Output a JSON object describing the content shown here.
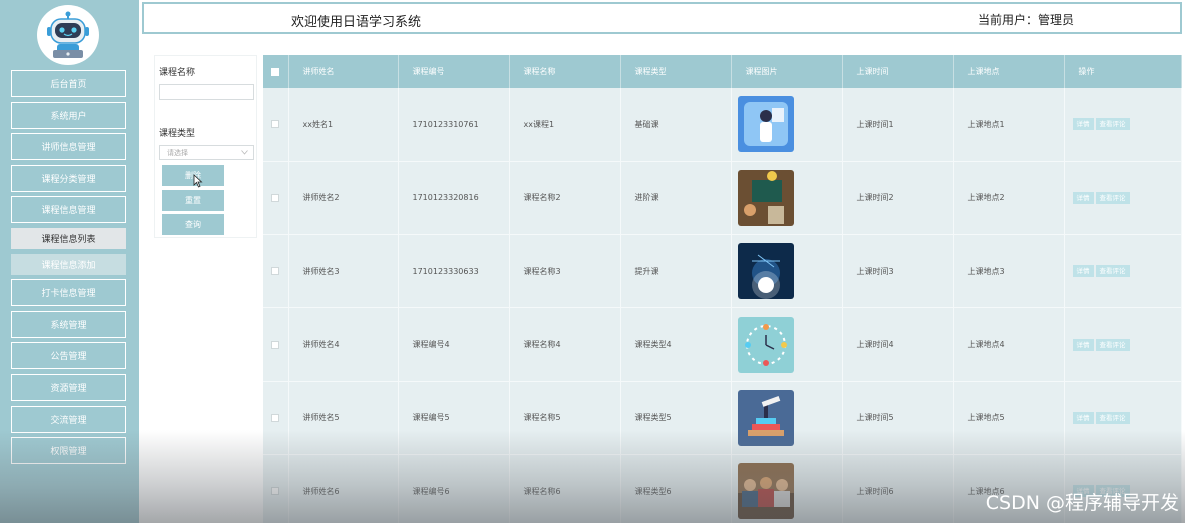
{
  "header": {
    "welcome": "欢迎使用日语学习系统",
    "user_label": "当前用户：",
    "user_name": "管理员"
  },
  "sidebar": {
    "items": [
      {
        "label": "后台首页",
        "state": "normal"
      },
      {
        "label": "系统用户",
        "state": "normal"
      },
      {
        "label": "讲师信息管理",
        "state": "normal"
      },
      {
        "label": "课程分类管理",
        "state": "normal"
      },
      {
        "label": "课程信息管理",
        "state": "normal"
      },
      {
        "label": "课程信息列表",
        "state": "active"
      },
      {
        "label": "课程信息添加",
        "state": "sub"
      },
      {
        "label": "打卡信息管理",
        "state": "normal"
      },
      {
        "label": "系统管理",
        "state": "normal"
      },
      {
        "label": "公告管理",
        "state": "normal"
      },
      {
        "label": "资源管理",
        "state": "normal"
      },
      {
        "label": "交流管理",
        "state": "normal"
      },
      {
        "label": "权限管理",
        "state": "normal"
      }
    ]
  },
  "filter": {
    "name_label": "课程名称",
    "name_value": "",
    "type_label": "课程类型",
    "type_placeholder": "请选择",
    "delete_label": "删除",
    "reset_label": "重置",
    "query_label": "查询"
  },
  "table": {
    "columns": [
      "讲师姓名",
      "课程编号",
      "课程名称",
      "课程类型",
      "课程图片",
      "上课时间",
      "上课地点",
      "操作"
    ],
    "detail_label": "详情",
    "comment_label": "查看评论",
    "rows": [
      {
        "teacher": "xx姓名1",
        "code": "1710123310761",
        "name": "xx课程1",
        "type": "基础课",
        "time": "上课时间1",
        "place": "上课地点1",
        "image": "teacher-illustration"
      },
      {
        "teacher": "讲师姓名2",
        "code": "1710123320816",
        "name": "课程名称2",
        "type": "进阶课",
        "time": "上课时间2",
        "place": "上课地点2",
        "image": "classroom-photo"
      },
      {
        "teacher": "讲师姓名3",
        "code": "1710123330633",
        "name": "课程名称3",
        "type": "提升课",
        "time": "上课时间3",
        "place": "上课地点3",
        "image": "lightbulb-illustration"
      },
      {
        "teacher": "讲师姓名4",
        "code": "课程编号4",
        "name": "课程名称4",
        "type": "课程类型4",
        "time": "上课时间4",
        "place": "上课地点4",
        "image": "clock-illustration"
      },
      {
        "teacher": "讲师姓名5",
        "code": "课程编号5",
        "name": "课程名称5",
        "type": "课程类型5",
        "time": "上课时间5",
        "place": "上课地点5",
        "image": "telescope-illustration"
      },
      {
        "teacher": "讲师姓名6",
        "code": "课程编号6",
        "name": "课程名称6",
        "type": "课程类型6",
        "time": "上课时间6",
        "place": "上课地点6",
        "image": "students-photo"
      }
    ]
  },
  "watermark": "CSDN @程序辅导开发",
  "colors": {
    "accent": "#9ec9d1",
    "row_bg": "#e6eff1",
    "op_button": "#bfe2e8"
  }
}
